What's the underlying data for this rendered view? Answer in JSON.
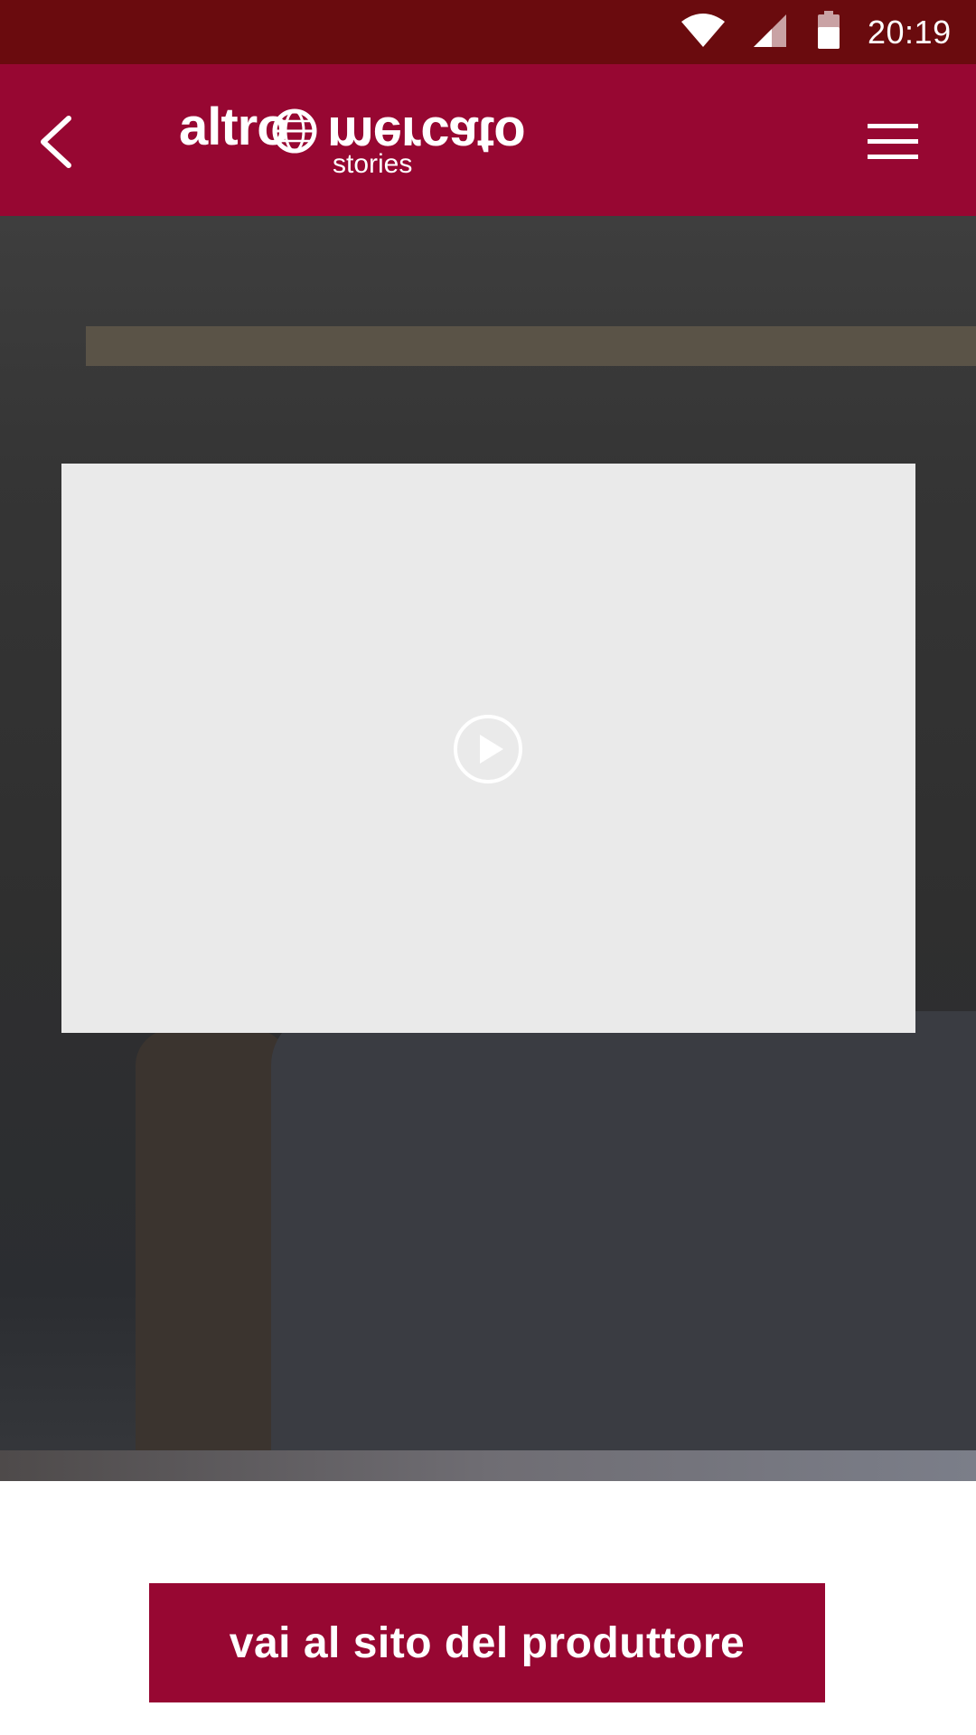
{
  "status_bar": {
    "time": "20:19",
    "icons": [
      "wifi-icon",
      "signal-icon",
      "battery-icon"
    ]
  },
  "app_bar": {
    "logo_main_left": "altro",
    "logo_main_right": "mercato",
    "logo_sub": "stories",
    "back_icon": "chevron-left-icon",
    "menu_icon": "hamburger-menu-icon"
  },
  "video": {
    "play_icon": "play-circle-icon"
  },
  "cta": {
    "label": "vai al sito del produttore"
  },
  "colors": {
    "status_bar": "#6a0b0e",
    "brand": "#970732",
    "video_placeholder": "#eaeaea"
  }
}
